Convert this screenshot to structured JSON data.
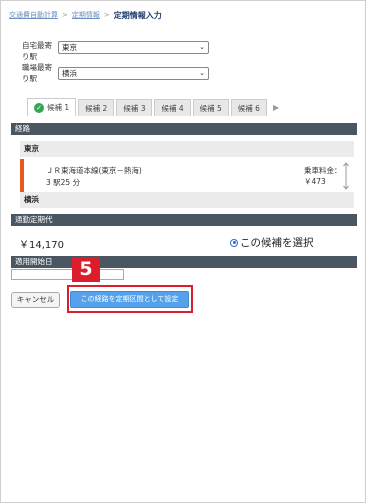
{
  "breadcrumb": {
    "items": [
      "交通費自動計算",
      "定期情報"
    ],
    "separator": ">",
    "current": "定期情報入力"
  },
  "form": {
    "home_label": "自宅最寄り駅",
    "home_label_line1": "自宅最寄",
    "home_label_line2": "り駅",
    "home_value": "東京",
    "work_label_line1": "職場最寄",
    "work_label_line2": "り駅",
    "work_value": "横浜"
  },
  "tabs": [
    {
      "label": "候補 1",
      "active": true,
      "checked": true
    },
    {
      "label": "候補 2",
      "active": false
    },
    {
      "label": "候補 3",
      "active": false
    },
    {
      "label": "候補 4",
      "active": false
    },
    {
      "label": "候補 5",
      "active": false
    },
    {
      "label": "候補 6",
      "active": false
    }
  ],
  "route": {
    "section_title": "経路",
    "from_station": "東京",
    "line": "ＪＲ東海道本線(東京－熱海)",
    "duration": "3 駅25 分",
    "fare_label": "乗車料金：",
    "fare_value": "￥473",
    "to_station": "横浜"
  },
  "commuter_pass": {
    "section_title": "通勤定期代",
    "price": "￥14,170",
    "select_label": "この候補を選択"
  },
  "start_date": {
    "section_title": "適用開始日",
    "value": ""
  },
  "annotation": {
    "step_number": "5"
  },
  "buttons": {
    "cancel": "キャンセル",
    "set_route": "この経路を定期区間として設定"
  },
  "colors": {
    "section_bar": "#4b5663",
    "accent_orange": "#e85a1a",
    "primary_button": "#55a2ea",
    "annotation_red": "#dc1d2b",
    "check_green": "#2fa84f"
  }
}
